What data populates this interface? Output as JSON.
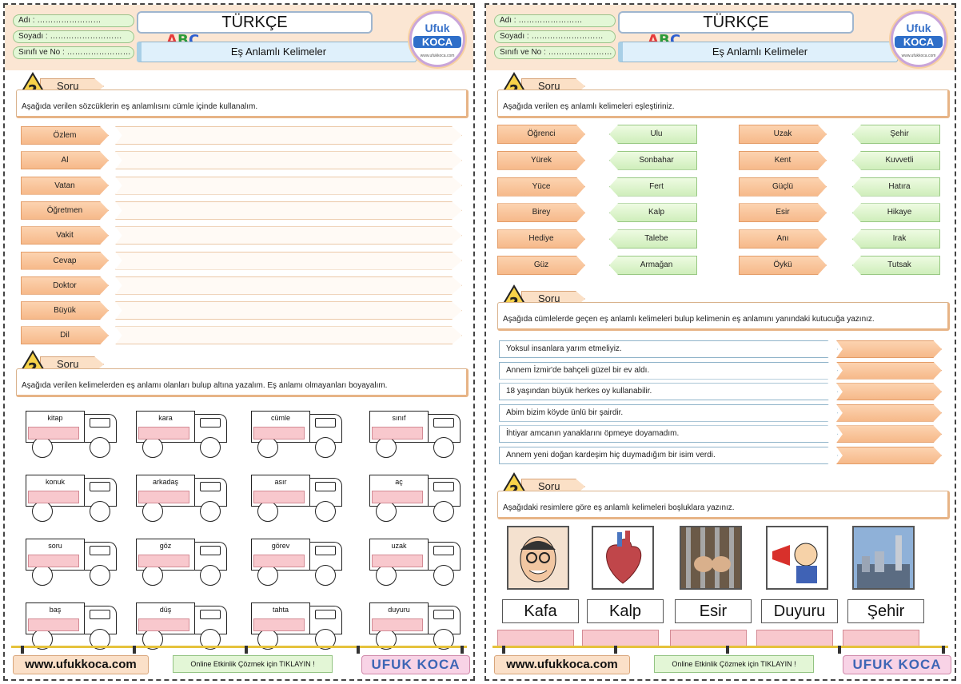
{
  "header": {
    "name_label": "Adı :",
    "name_dots": "……………………",
    "surname_label": "Soyadı :",
    "surname_dots": "………………………",
    "class_label": "Sınıfı ve No :",
    "class_dots": "……………………",
    "subject": "TÜRKÇE",
    "topic": "Eş Anlamlı Kelimeler"
  },
  "logo": {
    "top": "Ufuk",
    "main": "KOCA",
    "web": "www.ufukkoca.com"
  },
  "soru_label": "Soru",
  "left": {
    "q1": "Aşağıda verilen sözcüklerin eş anlamlısını cümle içinde kullanalım.",
    "words": [
      "Özlem",
      "Al",
      "Vatan",
      "Öğretmen",
      "Vakit",
      "Cevap",
      "Doktor",
      "Büyük",
      "Dil"
    ],
    "q2": "Aşağıda verilen kelimelerden eş anlamı olanları bulup altına yazalım. Eş anlamı olmayanları boyayalım.",
    "trucks": [
      "kitap",
      "kara",
      "cümle",
      "sınıf",
      "konuk",
      "arkadaş",
      "asır",
      "aç",
      "soru",
      "göz",
      "görev",
      "uzak",
      "baş",
      "düş",
      "tahta",
      "duyuru"
    ]
  },
  "right": {
    "q1": "Aşağıda verilen eş anlamlı kelimeleri eşleştiriniz.",
    "orange1": [
      "Öğrenci",
      "Yürek",
      "Yüce",
      "Birey",
      "Hediye",
      "Güz"
    ],
    "green1": [
      "Ulu",
      "Sonbahar",
      "Fert",
      "Kalp",
      "Talebe",
      "Armağan"
    ],
    "orange2": [
      "Uzak",
      "Kent",
      "Güçlü",
      "Esir",
      "Anı",
      "Öykü"
    ],
    "green2": [
      "Şehir",
      "Kuvvetli",
      "Hatıra",
      "Hikaye",
      "Irak",
      "Tutsak"
    ],
    "q2": "Aşağıda cümlelerde geçen eş anlamlı kelimeleri bulup kelimenin eş anlamını yanındaki kutucuğa yazınız.",
    "sentences": [
      "Yoksul insanlara yarım etmeliyiz.",
      "Annem İzmir'de bahçeli güzel bir ev aldı.",
      "18 yaşından büyük herkes oy kullanabilir.",
      "Abim bizim köyde ünlü bir şairdir.",
      "İhtiyar amcanın yanaklarını öpmeye doyamadım.",
      "Annem yeni doğan kardeşim hiç duymadığım bir isim verdi."
    ],
    "q3": "Aşağıdaki resimlere göre eş anlamlı kelimeleri boşluklara yazınız.",
    "pictures": [
      "Kafa",
      "Kalp",
      "Esir",
      "Duyuru",
      "Şehir"
    ]
  },
  "footer": {
    "url": "www.ufukkoca.com",
    "button": "Online Etkinlik Çözmek için TIKLAYIN !",
    "brand": "UFUK KOCA"
  }
}
